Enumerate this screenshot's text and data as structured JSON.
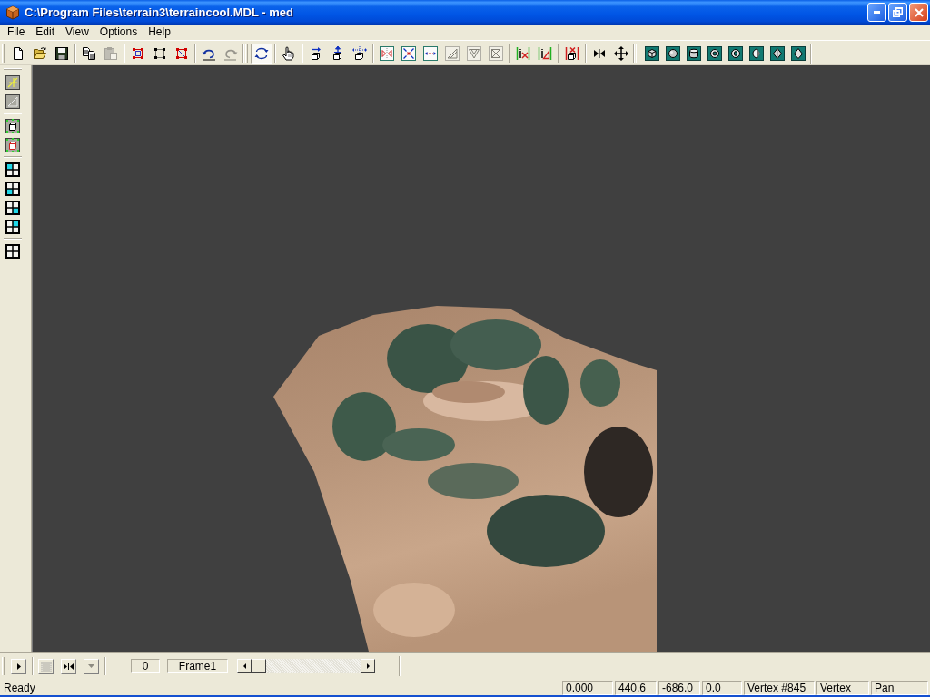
{
  "window": {
    "title": "C:\\Program Files\\terrain3\\terraincool.MDL - med"
  },
  "menu": [
    "File",
    "Edit",
    "View",
    "Options",
    "Help"
  ],
  "toolbar": {
    "groups": [
      {
        "buttons": [
          {
            "disabled": false,
            "pressed": false
          },
          {
            "disabled": false,
            "pressed": false
          },
          {
            "disabled": false,
            "pressed": false
          }
        ]
      },
      {
        "buttons": [
          {
            "disabled": false,
            "pressed": false
          },
          {
            "disabled": true,
            "pressed": false
          }
        ]
      },
      {
        "buttons": [
          {
            "disabled": false,
            "pressed": false
          },
          {
            "disabled": false,
            "pressed": false
          },
          {
            "disabled": false,
            "pressed": false
          }
        ]
      },
      {
        "buttons": [
          {
            "disabled": false,
            "pressed": false
          },
          {
            "disabled": true,
            "pressed": false
          }
        ]
      },
      {
        "buttons": [
          {
            "disabled": false,
            "pressed": true
          }
        ]
      },
      {
        "buttons": [
          {
            "disabled": false,
            "pressed": false
          }
        ]
      },
      {
        "buttons": [
          {
            "disabled": false,
            "pressed": false
          },
          {
            "disabled": false,
            "pressed": false
          },
          {
            "disabled": false,
            "pressed": false
          }
        ]
      },
      {
        "buttons": [
          {
            "disabled": false,
            "pressed": false
          },
          {
            "disabled": false,
            "pressed": false
          },
          {
            "disabled": false,
            "pressed": false
          },
          {
            "disabled": true,
            "pressed": false
          },
          {
            "disabled": true,
            "pressed": false
          },
          {
            "disabled": true,
            "pressed": false
          }
        ]
      },
      {
        "buttons": [
          {
            "disabled": false,
            "pressed": false
          },
          {
            "disabled": false,
            "pressed": false
          }
        ]
      },
      {
        "buttons": [
          {
            "disabled": false,
            "pressed": false
          }
        ]
      },
      {
        "buttons": [
          {
            "disabled": false,
            "pressed": false
          },
          {
            "disabled": false,
            "pressed": false
          }
        ]
      },
      {
        "buttons": [
          {
            "disabled": false,
            "pressed": false
          },
          {
            "disabled": false,
            "pressed": false
          },
          {
            "disabled": false,
            "pressed": false
          },
          {
            "disabled": false,
            "pressed": false
          },
          {
            "disabled": false,
            "pressed": false
          },
          {
            "disabled": false,
            "pressed": false
          },
          {
            "disabled": false,
            "pressed": false
          },
          {
            "disabled": false,
            "pressed": false
          }
        ]
      }
    ]
  },
  "side_toolbar": {
    "groups": [
      {
        "buttons": [
          {
            "pressed": false
          },
          {
            "pressed": false
          }
        ]
      },
      {
        "buttons": [
          {
            "pressed": false
          },
          {
            "pressed": false
          }
        ]
      },
      {
        "buttons": [
          {
            "pressed": false
          },
          {
            "pressed": false
          },
          {
            "pressed": false
          },
          {
            "pressed": false
          }
        ]
      },
      {
        "buttons": [
          {
            "pressed": false
          }
        ]
      }
    ]
  },
  "animation_bar": {
    "buttons": [
      {
        "disabled": false
      },
      {
        "disabled": true
      },
      {
        "disabled": false
      },
      {
        "disabled": true
      }
    ],
    "frame_number": "0",
    "frame_name": "Frame1"
  },
  "status_bar": {
    "message": "Ready",
    "panes": [
      "0.000",
      "440.6",
      "-686.0",
      "0.0",
      "Vertex #845",
      "Vertex",
      "Pan"
    ]
  }
}
